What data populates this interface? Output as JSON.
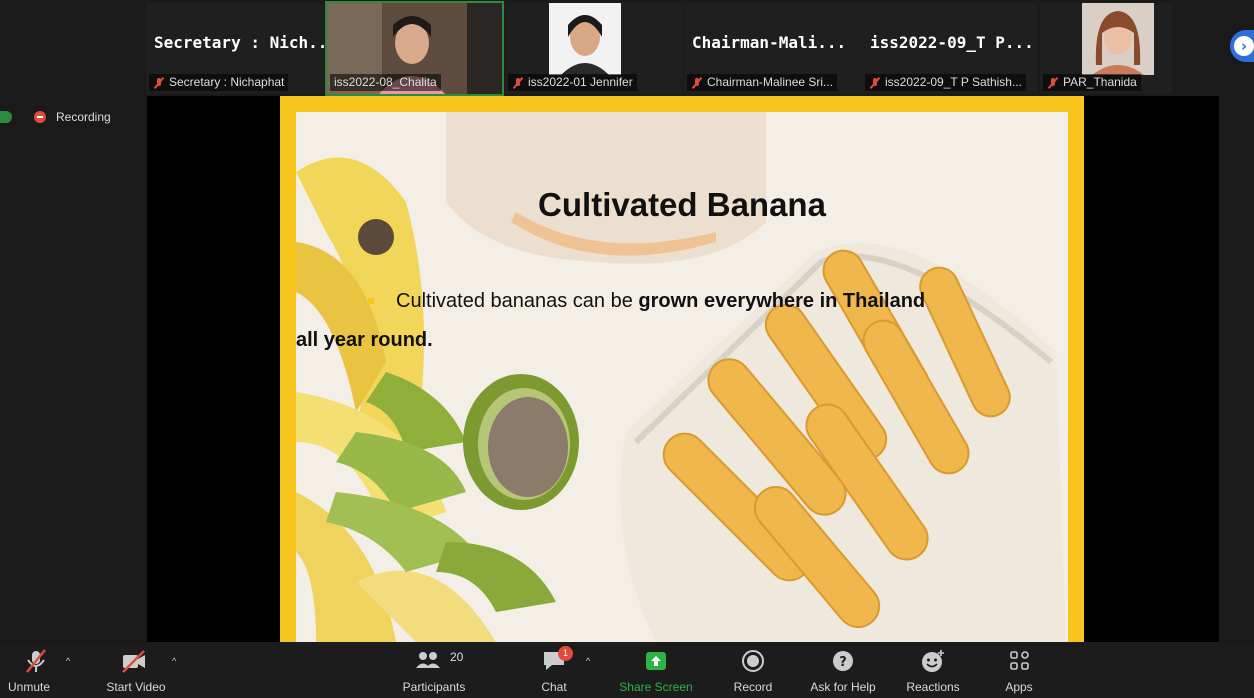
{
  "participants": {
    "secretary": {
      "display_name": "Secretary : Nich...",
      "caption": "Secretary : Nichaphat"
    },
    "chalita": {
      "caption": "iss2022-08_Chalita"
    },
    "jennifer": {
      "caption": "iss2022-01 Jennifer"
    },
    "chairman": {
      "display_name": "Chairman-Mali...",
      "caption": "Chairman-Malinee Sri..."
    },
    "sathish": {
      "display_name": "iss2022-09_T P...",
      "caption": "iss2022-09_T P Sathish..."
    },
    "thanida": {
      "caption": "PAR_Thanida"
    }
  },
  "recording": {
    "label": "Recording"
  },
  "slide": {
    "title": "Cultivated Banana",
    "body_prefix": "Cultivated bananas can be ",
    "body_bold1": "grown everywhere in Thailand",
    "body_bold2": "all year round."
  },
  "toolbar": {
    "unmute": "Unmute",
    "start_video": "Start Video",
    "participants": "Participants",
    "participant_count": "20",
    "chat": "Chat",
    "chat_badge": "1",
    "share_screen": "Share Screen",
    "record": "Record",
    "ask_for_help": "Ask for Help",
    "reactions": "Reactions",
    "apps": "Apps"
  },
  "colors": {
    "accent_green": "#2d8c3c",
    "record_red": "#e14b3b",
    "slide_yellow": "#f7c51e",
    "share_green": "#2fb344"
  }
}
